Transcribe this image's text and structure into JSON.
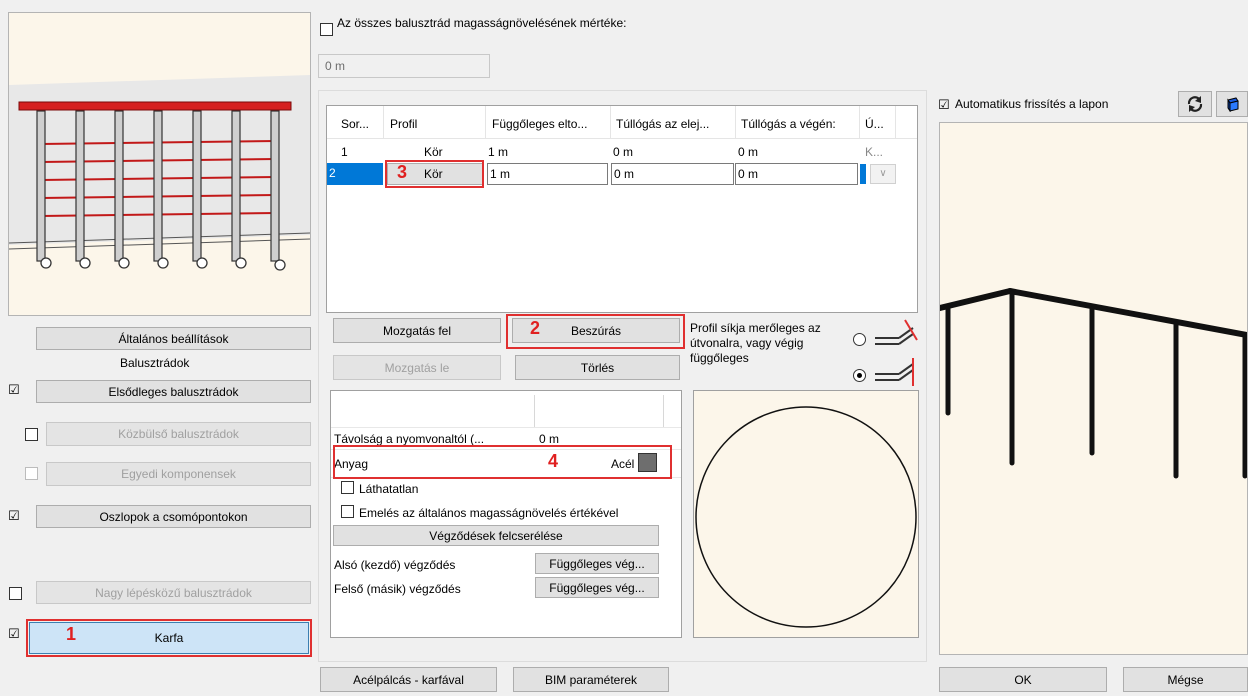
{
  "left": {
    "general_settings": "Általános beállítások",
    "balusters_group": "Balusztrádok",
    "primary": "Elsődleges balusztrádok",
    "intermediate": "Közbülső balusztrádok",
    "custom": "Egyedi komponensek",
    "posts": "Oszlopok a csomópontokon",
    "large_step": "Nagy lépésközű balusztrádok",
    "handrail": "Karfa",
    "check_mark": "☑"
  },
  "top": {
    "all_height_label": "Az összes balusztrád magasságnövelésének mértéke:",
    "all_height_value": "0 m"
  },
  "table": {
    "headers": [
      "Sor...",
      "Profil",
      "Függőleges elto...",
      "Túllógás az elej...",
      "Túllógás a végén:",
      "Ú..."
    ],
    "rows": [
      [
        "1",
        "Kör",
        "1 m",
        "0 m",
        "0 m",
        "K..."
      ],
      [
        "2",
        "Kör",
        "1 m",
        "0 m",
        "0 m",
        ""
      ]
    ]
  },
  "actions": {
    "move_up": "Mozgatás fel",
    "insert": "Beszúrás",
    "move_down": "Mozgatás le",
    "delete": "Törlés",
    "profile_plane_note": "Profil síkja merőleges az útvonalra, vagy végig függőleges"
  },
  "props": {
    "distance_label": "Távolság a nyomvonaltól (...",
    "distance_value": "0 m",
    "material_label": "Anyag",
    "material_value": "Acél",
    "material_color": "#6e6e6e",
    "invisible": "Láthatatlan",
    "raise": "Emelés az általános magasságnövelés értékével",
    "swap_ends": "Végződések felcserélése",
    "bottom_end_label": "Alsó (kezdő) végződés",
    "bottom_end_value": "Függőleges vég...",
    "top_end_label": "Felső (másik) végződés",
    "top_end_value": "Függőleges vég..."
  },
  "preview": {
    "auto_refresh": "Automatikus frissítés a lapon"
  },
  "footer": {
    "steel_rod": "Acélpálcás - karfával",
    "bim": "BIM paraméterek",
    "ok": "OK",
    "cancel": "Mégse"
  },
  "markers": [
    "1",
    "2",
    "3",
    "4"
  ],
  "colors": {
    "accent_red": "#e03030",
    "selection_blue": "#0078d7",
    "rail_red": "#d62020",
    "preview_bg": "#fcf6ea"
  }
}
